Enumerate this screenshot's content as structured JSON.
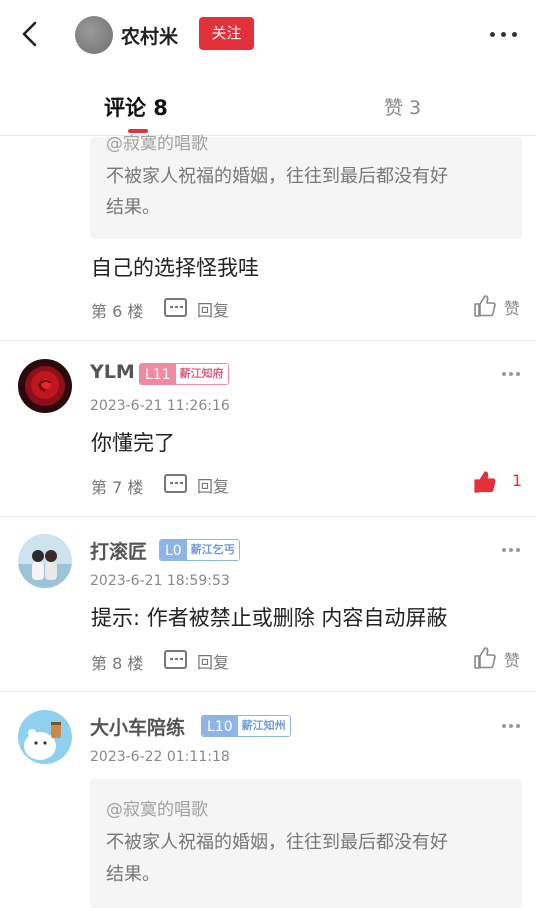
{
  "header": {
    "author_name": "农村米",
    "follow_label": "关注"
  },
  "tabs": {
    "comments_label": "评论 8",
    "likes_label": "赞 3"
  },
  "comments": [
    {
      "quote_at": "@寂寞的唱歌",
      "quote_line1": "不被家人祝福的婚姻，往往到最后都没有好",
      "quote_line2": "结果。",
      "text": "自己的选择怪我哇",
      "floor": "第 6 楼",
      "reply_label": "回复",
      "like_label": "赞"
    },
    {
      "user": "YLM",
      "level": "L11",
      "level_title": "薪江知府",
      "time": "2023-6-21 11:26:16",
      "text": "你懂完了",
      "floor": "第 7 楼",
      "reply_label": "回复",
      "like_count": "1"
    },
    {
      "user": "打滚匠",
      "level": "L0",
      "level_title": "薪江乞丐",
      "time": "2023-6-21 18:59:53",
      "text": "提示: 作者被禁止或删除 内容自动屏蔽",
      "floor": "第 8 楼",
      "reply_label": "回复",
      "like_label": "赞"
    },
    {
      "user": "大小车陪练",
      "level": "L10",
      "level_title": "薪江知州",
      "time": "2023-6-22 01:11:18",
      "quote_at": "@寂寞的唱歌",
      "quote_line1": "不被家人祝福的婚姻，往往到最后都没有好",
      "quote_line2": "结果。"
    }
  ],
  "colors": {
    "accent": "#e2313a",
    "level_pink": "#f08aa0",
    "level_blue": "#8fb4e8"
  }
}
